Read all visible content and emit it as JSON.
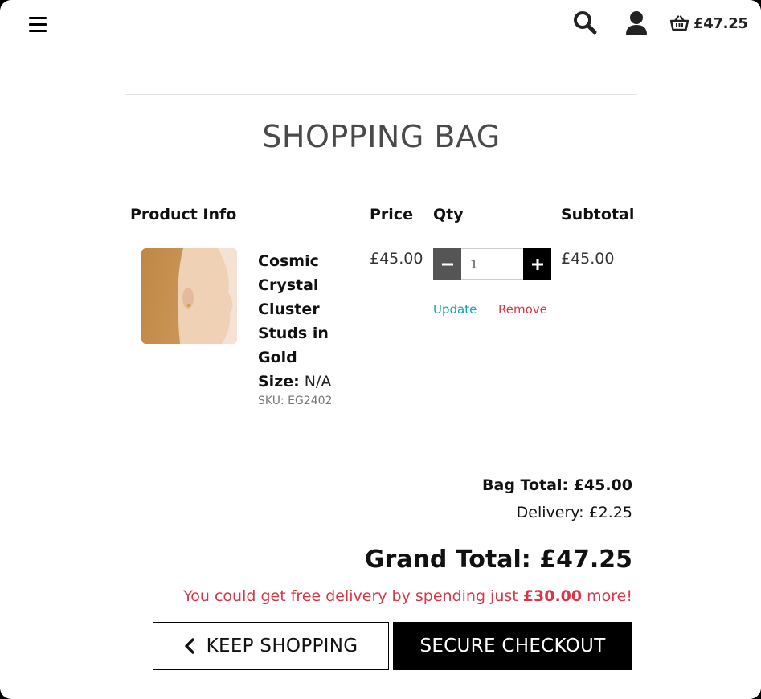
{
  "header": {
    "menu_icon": "hamburger-icon",
    "search_icon": "search-icon",
    "account_icon": "user-icon",
    "bag_icon": "basket-icon",
    "bag_total": "£47.25"
  },
  "page": {
    "title": "SHOPPING BAG"
  },
  "table": {
    "headers": {
      "product": "Product Info",
      "price": "Price",
      "qty": "Qty",
      "subtotal": "Subtotal"
    },
    "items": [
      {
        "name": "Cosmic Crystal Cluster Studs in Gold",
        "size_label": "Size:",
        "size_value": "N/A",
        "sku": "SKU: EG2402",
        "price": "£45.00",
        "quantity": "1",
        "subtotal": "£45.00",
        "update_label": "Update",
        "remove_label": "Remove"
      }
    ]
  },
  "summary": {
    "bag_total": "Bag Total: £45.00",
    "delivery": "Delivery: £2.25",
    "grand_total": "Grand Total: £47.25",
    "free_delivery_prefix": "You could get free delivery by spending just",
    "free_delivery_amount": "£30.00",
    "free_delivery_suffix": "more!"
  },
  "actions": {
    "keep_shopping": "KEEP SHOPPING",
    "secure_checkout": "SECURE CHECKOUT"
  },
  "colors": {
    "accent_link": "#17a2b8",
    "danger": "#dc3545",
    "primary_button": "#000000"
  }
}
